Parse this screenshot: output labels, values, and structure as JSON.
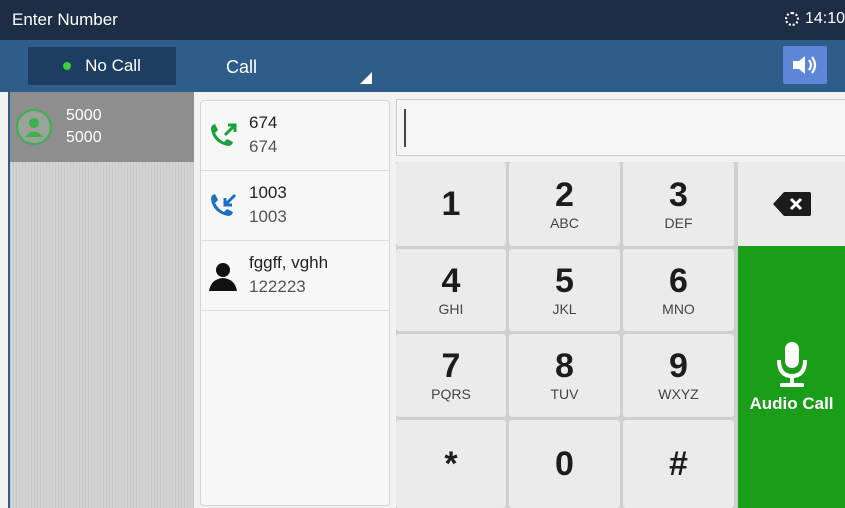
{
  "titlebar": {
    "title": "Enter Number",
    "time": "14:10"
  },
  "toolbar": {
    "status": "No Call",
    "call_mode": "Call"
  },
  "account": {
    "name": "5000",
    "number": "5000"
  },
  "history": [
    {
      "name": "674",
      "number": "674",
      "type": "outgoing"
    },
    {
      "name": "1003",
      "number": "1003",
      "type": "incoming"
    },
    {
      "name": "fggff, vghh",
      "number": "122223",
      "type": "contact"
    }
  ],
  "input": {
    "value": ""
  },
  "keypad": {
    "keys": [
      {
        "digit": "1",
        "letters": ""
      },
      {
        "digit": "2",
        "letters": "ABC"
      },
      {
        "digit": "3",
        "letters": "DEF"
      },
      {
        "digit": "4",
        "letters": "GHI"
      },
      {
        "digit": "5",
        "letters": "JKL"
      },
      {
        "digit": "6",
        "letters": "MNO"
      },
      {
        "digit": "7",
        "letters": "PQRS"
      },
      {
        "digit": "8",
        "letters": "TUV"
      },
      {
        "digit": "9",
        "letters": "WXYZ"
      },
      {
        "digit": "*",
        "letters": ""
      },
      {
        "digit": "0",
        "letters": ""
      },
      {
        "digit": "#",
        "letters": ""
      }
    ],
    "audio_call_label": "Audio Call"
  },
  "colors": {
    "titlebar": "#1d2d45",
    "toolbar": "#2f5d8a",
    "call_green": "#1a9e1a",
    "status_green": "#3ecf3a",
    "speaker_button": "#5b87d6"
  },
  "icons": {
    "sync": "sync-icon",
    "speaker": "speaker-icon",
    "backspace": "backspace-icon",
    "mic": "microphone-icon",
    "outgoing": "outgoing-call-icon",
    "incoming": "incoming-call-icon",
    "contact": "contact-icon",
    "avatar": "account-avatar-icon"
  }
}
